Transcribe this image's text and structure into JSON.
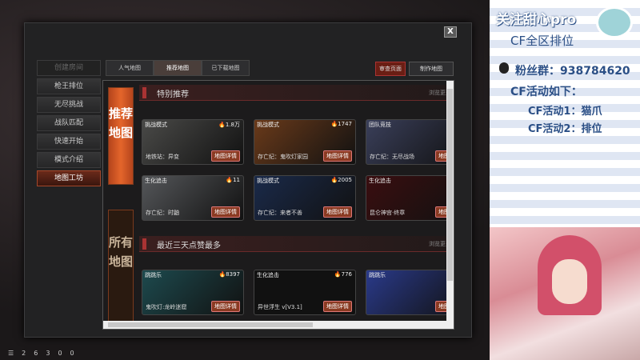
{
  "close_label": "X",
  "menu": [
    "创建房间",
    "枪王排位",
    "无尽挑战",
    "战队匹配",
    "快速开始",
    "模式介绍",
    "地图工坊"
  ],
  "tabs": [
    "人气地图",
    "推荐地图",
    "已下载地图"
  ],
  "home_btn": "审查页面",
  "make_btn": "制作地图",
  "vtab_recommended": "推荐地图",
  "vtab_all": "所有地图",
  "section1": {
    "title": "特别推荐",
    "more": "浏览更多"
  },
  "section2": {
    "title": "最近三天点赞最多",
    "more": "浏览更多"
  },
  "detail_label": "地图详情",
  "cards": [
    {
      "mode": "挑战模式",
      "heat": "1.8万",
      "name": "地铁站：异变",
      "color": "#4a4a48"
    },
    {
      "mode": "挑战模式",
      "heat": "1747",
      "name": "存亡纪：鬼吹灯家园",
      "color": "#6a3a1a"
    },
    {
      "mode": "团队竞技",
      "heat": "",
      "name": "存亡纪：无尽战场",
      "color": "#3a3f5a"
    },
    {
      "mode": "生化追击",
      "heat": "11",
      "name": "存亡纪：时鼬",
      "color": "#55575a"
    },
    {
      "mode": "挑战模式",
      "heat": "2005",
      "name": "存亡纪：来者不善",
      "color": "#1a2a4a"
    },
    {
      "mode": "生化追击",
      "heat": "",
      "name": "昆仑神宫·终章",
      "color": "#3a0e10"
    },
    {
      "mode": "跳跳乐",
      "heat": "8397",
      "name": "鬼吹灯:龙岭迷窟",
      "color": "#1d4a4e"
    },
    {
      "mode": "生化追击",
      "heat": "776",
      "name": "异世浮生 v[V3.1]",
      "color": "#111"
    },
    {
      "mode": "跳跳乐",
      "heat": "",
      "name": "",
      "color": "#2a3a8a"
    }
  ],
  "overlay": {
    "line1": "关注甜心pro",
    "line2": "CF全区排位",
    "fans": "粉丝群：938784620",
    "act_title": "CF活动如下：",
    "act1": "CF活动1：猫爪",
    "act2": "CF活动2：排位"
  },
  "status": [
    "2",
    "6",
    "3",
    "0",
    "0"
  ]
}
